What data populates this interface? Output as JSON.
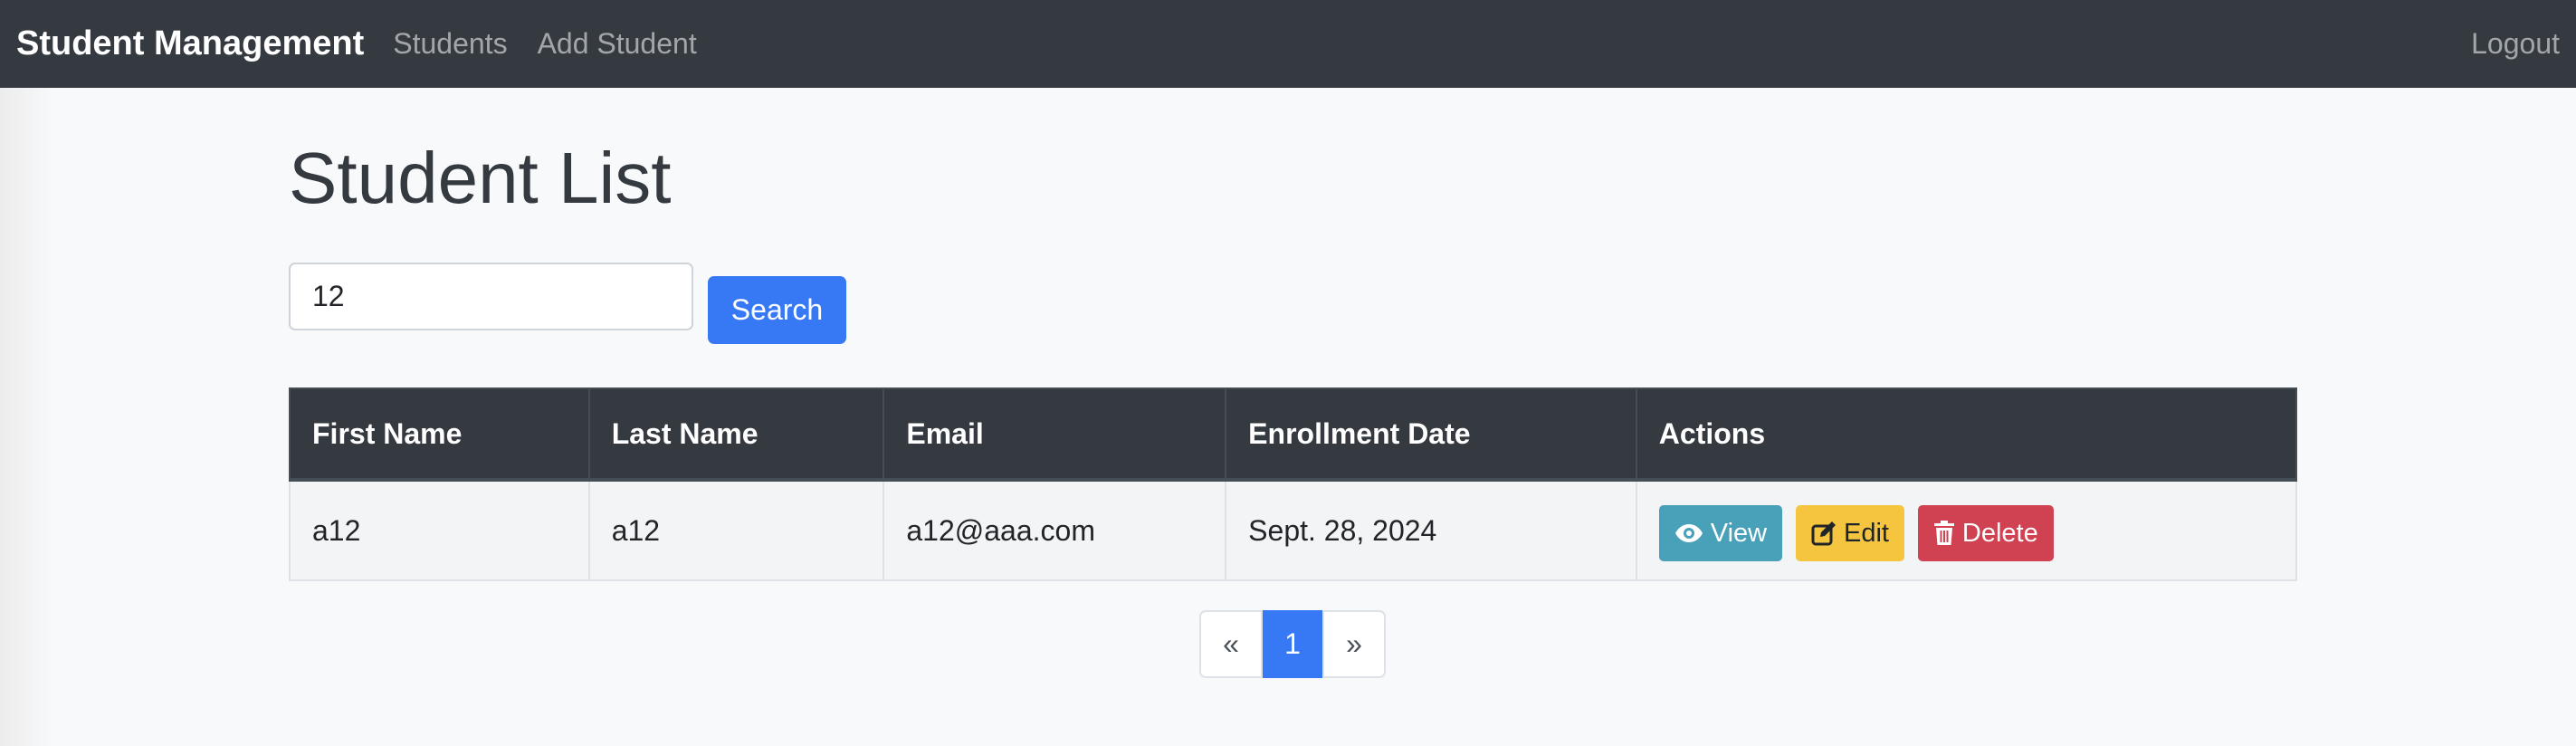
{
  "navbar": {
    "brand": "Student Management",
    "links": [
      "Students",
      "Add Student"
    ],
    "logout": "Logout"
  },
  "page": {
    "title": "Student List"
  },
  "search": {
    "value": "12",
    "button_label": "Search"
  },
  "table": {
    "headers": [
      "First Name",
      "Last Name",
      "Email",
      "Enrollment Date",
      "Actions"
    ],
    "rows": [
      {
        "first_name": "a12",
        "last_name": "a12",
        "email": "a12@aaa.com",
        "enrollment_date": "Sept. 28, 2024",
        "actions": {
          "view": "View",
          "edit": "Edit",
          "delete": "Delete"
        }
      }
    ]
  },
  "pagination": {
    "prev": "«",
    "current": "1",
    "next": "»"
  },
  "colors": {
    "navbar_bg": "#343a40",
    "primary": "#3779f5",
    "info": "#48a1b8",
    "warning": "#f5c53f",
    "danger": "#d04152"
  },
  "icons": {
    "view": "eye-icon",
    "edit": "edit-icon",
    "delete": "trash-icon"
  }
}
